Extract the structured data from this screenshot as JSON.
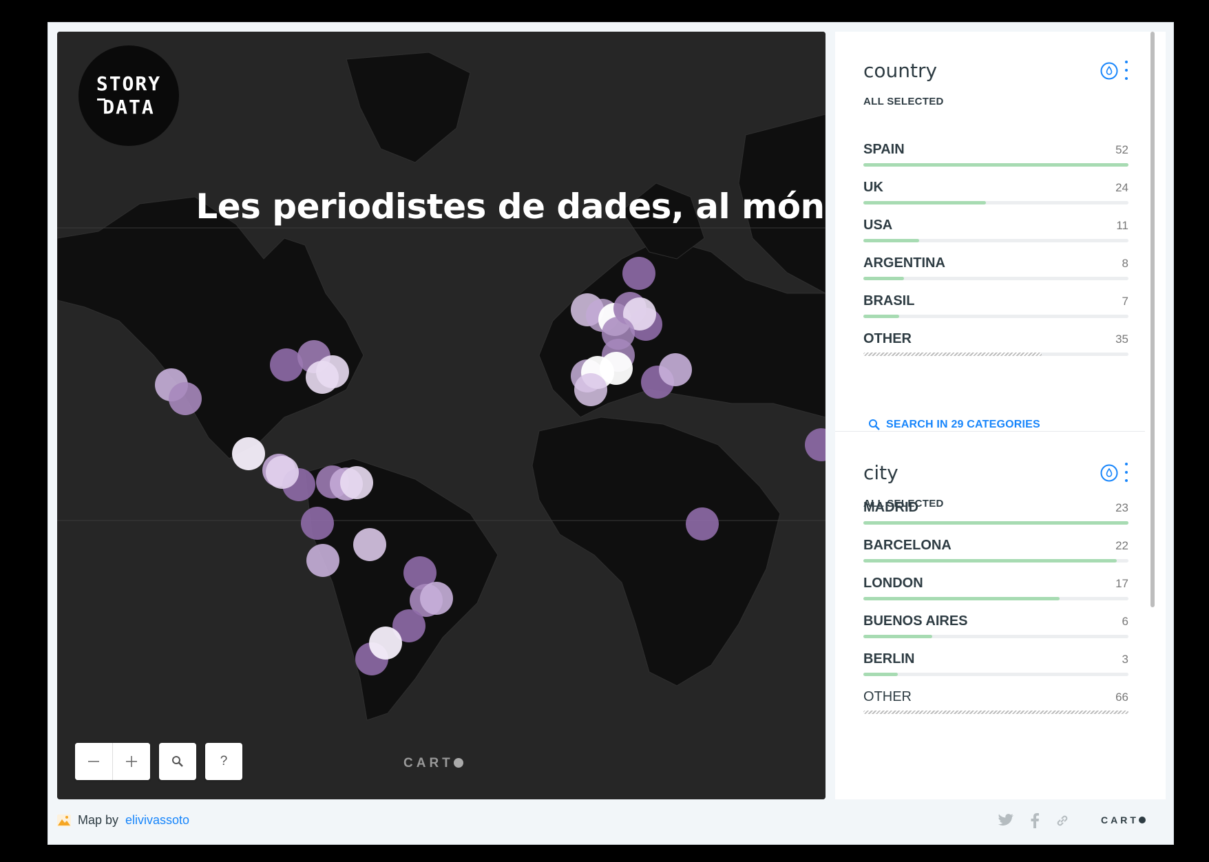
{
  "map": {
    "title": "Les periodistes de dades, al món",
    "logo_line1": "STORY",
    "logo_line2": "DATA",
    "carto_watermark": "CART",
    "controls": {
      "zoom_out_icon": "minus-icon",
      "zoom_in_icon": "plus-icon",
      "search_icon": "search-icon",
      "help_label": "?"
    },
    "colors": {
      "background": "#262626",
      "land": "#0f0f0f",
      "marker_light": "#f4eefa",
      "marker_dark": "#8f6ca8"
    }
  },
  "widgets": {
    "country": {
      "title": "country",
      "subtitle": "ALL SELECTED",
      "categories": [
        {
          "name": "SPAIN",
          "value": 52
        },
        {
          "name": "UK",
          "value": 24
        },
        {
          "name": "USA",
          "value": 11
        },
        {
          "name": "ARGENTINA",
          "value": 8
        },
        {
          "name": "BRASIL",
          "value": 7
        },
        {
          "name": "OTHER",
          "value": 35
        }
      ],
      "search_label": "SEARCH IN 29 CATEGORIES"
    },
    "city": {
      "title": "city",
      "subtitle": "ALL SELECTED",
      "categories": [
        {
          "name": "MADRID",
          "value": 23
        },
        {
          "name": "BARCELONA",
          "value": 22
        },
        {
          "name": "LONDON",
          "value": 17
        },
        {
          "name": "BUENOS AIRES",
          "value": 6
        },
        {
          "name": "BERLIN",
          "value": 3
        },
        {
          "name": "OTHER",
          "value": 66
        }
      ]
    }
  },
  "footer": {
    "map_by": "Map by",
    "author": "elivivassoto",
    "carto_logo": "CART",
    "social_icons": [
      "twitter-icon",
      "facebook-icon",
      "link-icon"
    ]
  }
}
